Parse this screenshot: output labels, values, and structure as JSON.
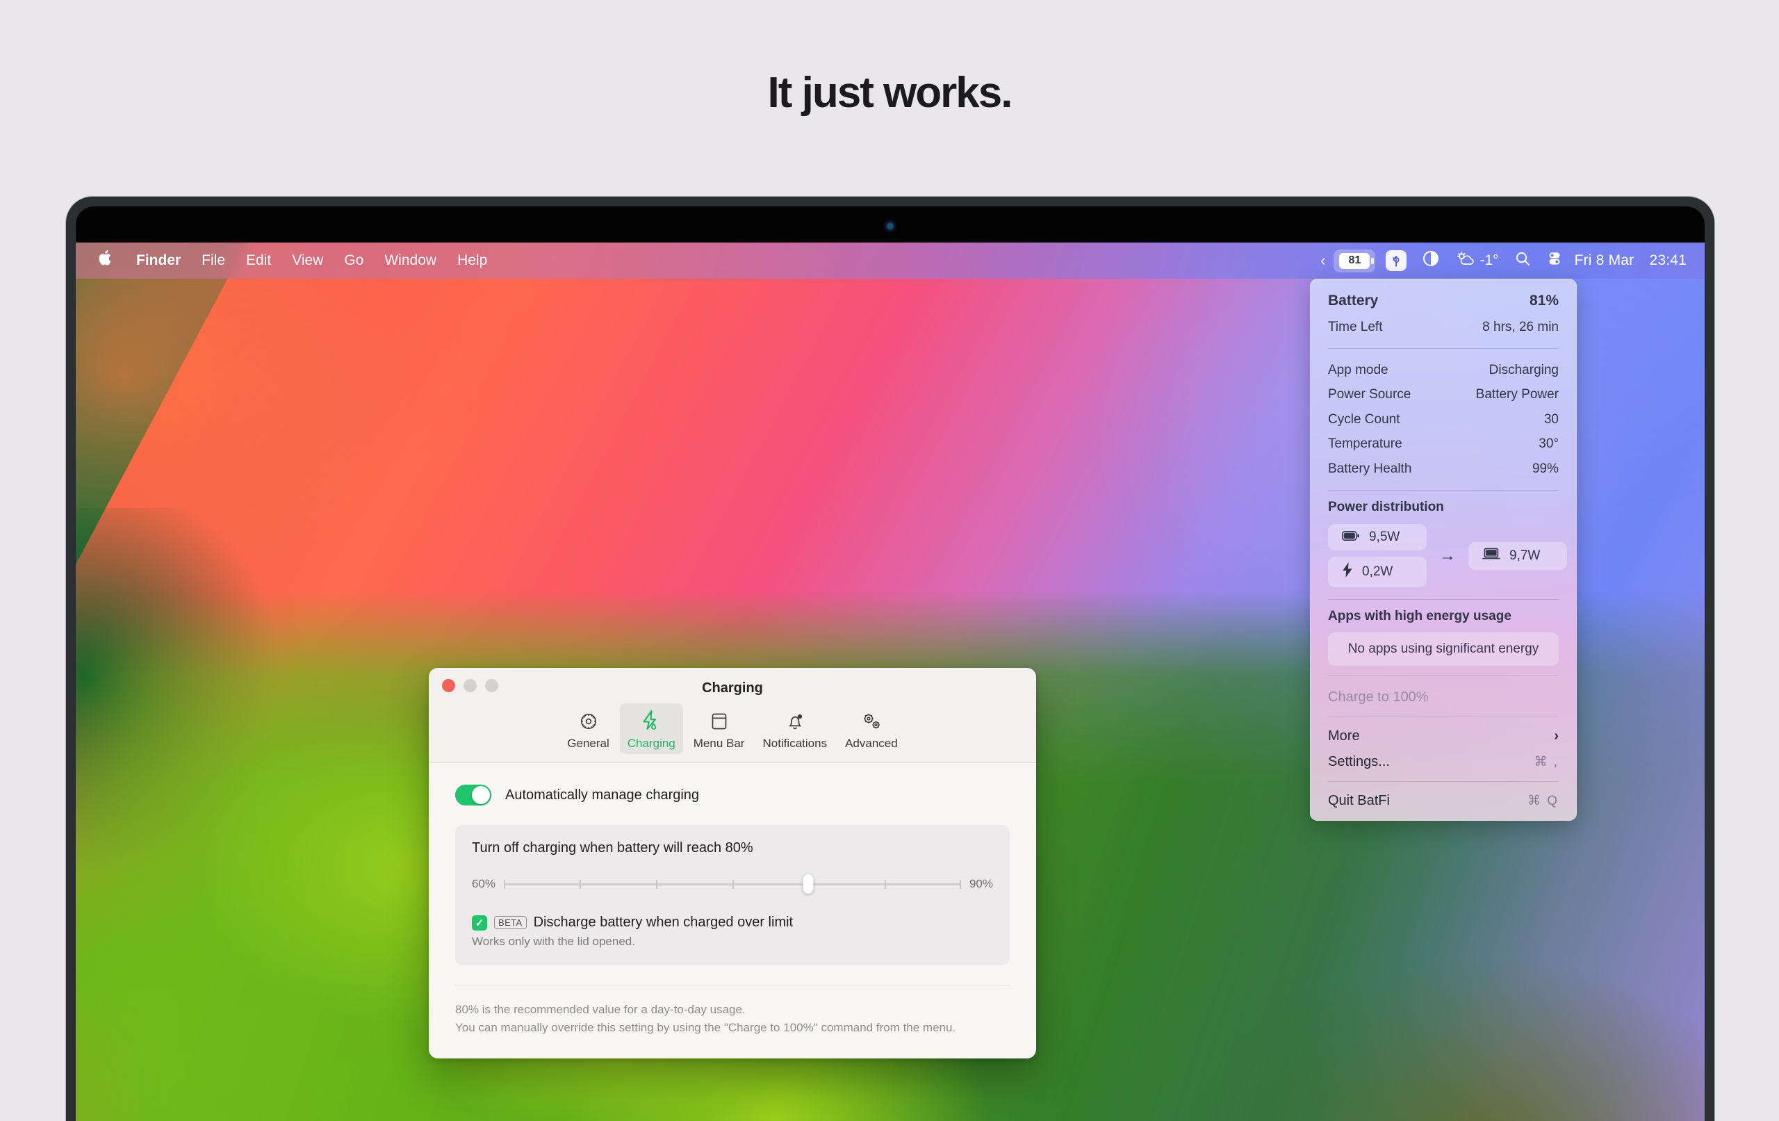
{
  "hero": {
    "headline": "It just works."
  },
  "menubar": {
    "apple_glyph": "",
    "items": [
      {
        "label": "Finder",
        "bold": true
      },
      {
        "label": "File",
        "bold": false
      },
      {
        "label": "Edit",
        "bold": false
      },
      {
        "label": "View",
        "bold": false
      },
      {
        "label": "Go",
        "bold": false
      },
      {
        "label": "Window",
        "bold": false
      },
      {
        "label": "Help",
        "bold": false
      }
    ],
    "status": {
      "collapse_chevron": "‹",
      "battery_percent_short": "81",
      "usb_icon": "usb-icon",
      "display_icon": "display-contrast-icon",
      "weather_temp": "-1°",
      "weather_icon": "cloud-sun-icon",
      "search_icon": "search-icon",
      "control_center_icon": "control-center-icon",
      "date": "Fri 8 Mar",
      "time": "23:41"
    }
  },
  "batfi": {
    "battery_label": "Battery",
    "battery_value": "81%",
    "time_left_label": "Time Left",
    "time_left_value": "8 hrs, 26 min",
    "stats": [
      {
        "label": "App mode",
        "value": "Discharging"
      },
      {
        "label": "Power Source",
        "value": "Battery Power"
      },
      {
        "label": "Cycle Count",
        "value": "30"
      },
      {
        "label": "Temperature",
        "value": "30°"
      },
      {
        "label": "Battery Health",
        "value": "99%"
      }
    ],
    "power_distribution_title": "Power distribution",
    "power_in": [
      {
        "icon": "battery-icon",
        "value": "9,5W"
      },
      {
        "icon": "bolt-icon",
        "value": "0,2W"
      }
    ],
    "power_arrow": "→",
    "power_out": {
      "icon": "laptop-icon",
      "value": "9,7W"
    },
    "apps_title": "Apps with high energy usage",
    "apps_empty": "No apps using significant energy",
    "menu": [
      {
        "label": "Charge to 100%",
        "shortcut": "",
        "disabled": true,
        "chevron": false
      },
      {
        "label": "More",
        "shortcut": "",
        "disabled": false,
        "chevron": true
      },
      {
        "label": "Settings...",
        "shortcut": "⌘ ,",
        "disabled": false,
        "chevron": false
      },
      {
        "label": "Quit BatFi",
        "shortcut": "⌘ Q",
        "disabled": false,
        "chevron": false
      }
    ]
  },
  "settings_window": {
    "title": "Charging",
    "traffic_lights": [
      "close",
      "minimize",
      "zoom"
    ],
    "tabs": [
      {
        "label": "General",
        "icon": "gear-outline-icon",
        "active": false
      },
      {
        "label": "Charging",
        "icon": "bolt-battery-icon",
        "active": true
      },
      {
        "label": "Menu Bar",
        "icon": "menubar-icon",
        "active": false
      },
      {
        "label": "Notifications",
        "icon": "bell-badge-icon",
        "active": false
      },
      {
        "label": "Advanced",
        "icon": "gears-icon",
        "active": false
      }
    ],
    "auto_manage": {
      "label": "Automatically manage charging",
      "enabled": true
    },
    "limit_card": {
      "title": "Turn off charging when battery will reach 80%",
      "slider": {
        "min_label": "60%",
        "max_label": "90%",
        "min": 60,
        "max": 90,
        "value": 80,
        "ticks": [
          65,
          70,
          75,
          80,
          85
        ]
      },
      "checkbox": {
        "checked": true,
        "badge": "BETA",
        "label": "Discharge battery when charged over limit",
        "sublabel": "Works only with the lid opened."
      }
    },
    "footer_lines": [
      "80% is the recommended value for a day-to-day usage.",
      "You can manually override this setting by using the \"Charge to 100%\" command from the menu."
    ]
  },
  "colors": {
    "accent_green": "#1fc46d",
    "tab_active_green": "#1fb760",
    "close_red": "#ef6258",
    "hero_bg": "#eae7ec"
  }
}
